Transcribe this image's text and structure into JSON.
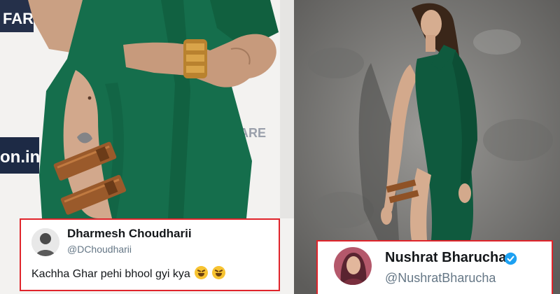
{
  "left_photo": {
    "backdrop_text_1": "FARE",
    "backdrop_text_2": "on.in",
    "backdrop_text_3": "FARE",
    "dress_color": "#146b4a"
  },
  "left_tweet": {
    "name": "Dharmesh Choudharii",
    "handle": "@DChoudharii",
    "text": "Kachha Ghar pehi bhool gyi kya",
    "emoji": "rolling-on-floor-laughing"
  },
  "right_photo": {
    "dress_color": "#0f5a3e",
    "background_color": "#7d7c7a"
  },
  "right_tweet": {
    "name": "Nushrat Bharucha",
    "handle": "@NushratBharucha",
    "verified_icon": "verified-badge-icon"
  },
  "accent_color": "#e0242b"
}
